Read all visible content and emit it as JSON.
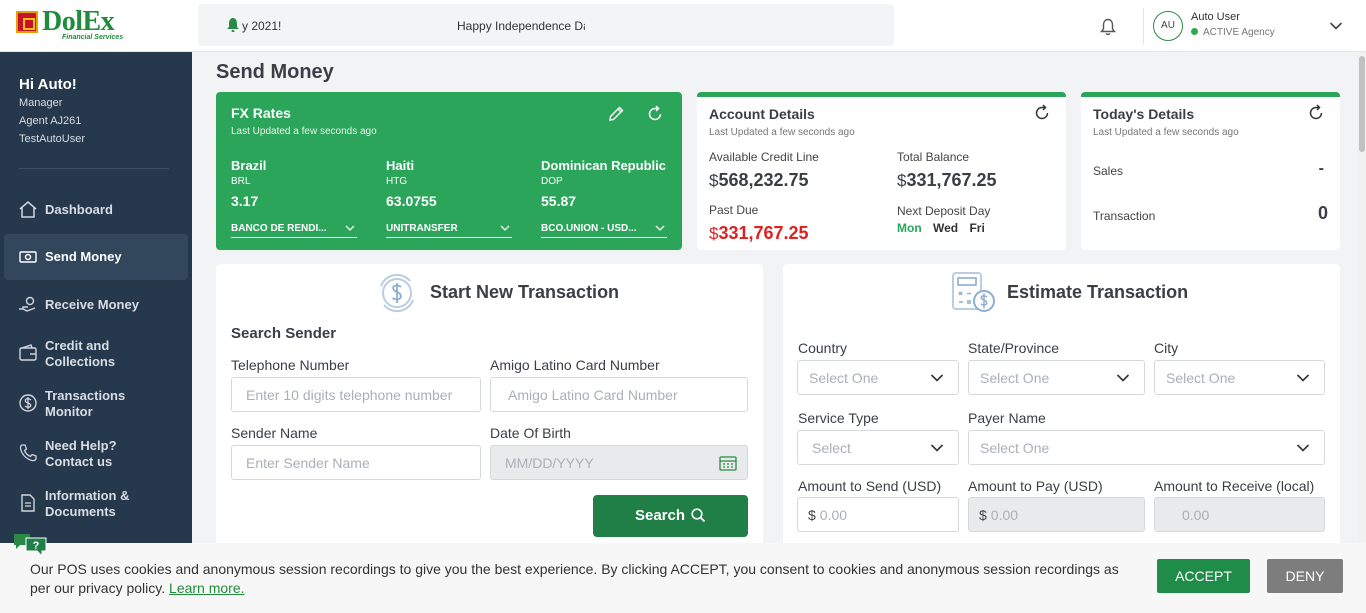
{
  "brand": {
    "name": "DolEx",
    "tagline": "Financial Services",
    "green": "#1f8c3b",
    "accent_green": "#2ba55a"
  },
  "ticker": {
    "left_text": "y 2021!",
    "right_text": "Happy Independence Da"
  },
  "user": {
    "initials": "AU",
    "name": "Auto User",
    "status": "ACTIVE Agency"
  },
  "sidebar": {
    "greeting": "Hi Auto!",
    "role": "Manager",
    "agent": "Agent AJ261",
    "username": "TestAutoUser",
    "items": [
      {
        "label": "Dashboard",
        "icon": "home-icon"
      },
      {
        "label": "Send Money",
        "icon": "money-icon"
      },
      {
        "label": "Receive Money",
        "icon": "hand-coin-icon"
      },
      {
        "label": "Credit and Collections",
        "icon": "wallet-icon"
      },
      {
        "label": "Transactions Monitor",
        "icon": "dollar-circle-icon"
      },
      {
        "label": "Need Help? Contact us",
        "icon": "phone-icon"
      },
      {
        "label": "Information & Documents",
        "icon": "document-icon"
      }
    ]
  },
  "page": {
    "title": "Send Money"
  },
  "fx": {
    "title": "FX Rates",
    "updated": "Last Updated a few seconds ago",
    "rates": [
      {
        "country": "Brazil",
        "code": "BRL",
        "rate": "3.17",
        "payer": "BANCO DE RENDI..."
      },
      {
        "country": "Haiti",
        "code": "HTG",
        "rate": "63.0755",
        "payer": "UNITRANSFER"
      },
      {
        "country": "Dominican Republic",
        "code": "DOP",
        "rate": "55.87",
        "payer": "BCO.UNION - USD..."
      }
    ]
  },
  "account": {
    "title": "Account Details",
    "updated": "Last Updated a few seconds ago",
    "available_credit_label": "Available Credit Line",
    "available_credit": "568,232.75",
    "total_balance_label": "Total Balance",
    "total_balance": "331,767.25",
    "past_due_label": "Past Due",
    "past_due": "331,767.25",
    "deposit_label": "Next Deposit Day",
    "currency": "$",
    "deposit_days": [
      "Mon",
      "Wed",
      "Fri"
    ]
  },
  "today": {
    "title": "Today's Details",
    "updated": "Last Updated a few seconds ago",
    "sales_label": "Sales",
    "sales_value": "-",
    "transaction_label": "Transaction",
    "transaction_value": "0"
  },
  "start": {
    "title": "Start New Transaction",
    "search_sender": "Search Sender",
    "telephone_label": "Telephone Number",
    "telephone_placeholder": "Enter 10 digits telephone number",
    "card_label": "Amigo Latino Card Number",
    "card_placeholder": "Amigo Latino Card Number",
    "name_label": "Sender Name",
    "name_placeholder": "Enter Sender Name",
    "dob_label": "Date Of Birth",
    "dob_placeholder": "MM/DD/YYYY",
    "search_button": "Search"
  },
  "estimate": {
    "title": "Estimate Transaction",
    "country_label": "Country",
    "country_value": "Select One",
    "state_label": "State/Province",
    "state_value": "Select One",
    "city_label": "City",
    "city_value": "Select One",
    "service_label": "Service Type",
    "service_value": "Select",
    "payer_label": "Payer Name",
    "payer_value": "Select One",
    "send_label": "Amount to Send (USD)",
    "send_value": "0.00",
    "pay_label": "Amount to Pay (USD)",
    "pay_value": "0.00",
    "receive_label": "Amount to Receive (local)",
    "receive_value": "0.00",
    "currency": "$"
  },
  "cookie": {
    "text": "Our POS uses cookies and anonymous session recordings to give you the best experience. By clicking ACCEPT, you consent to cookies and anonymous session recordings as per our privacy policy.",
    "link": "Learn more.",
    "accept": "ACCEPT",
    "deny": "DENY"
  }
}
